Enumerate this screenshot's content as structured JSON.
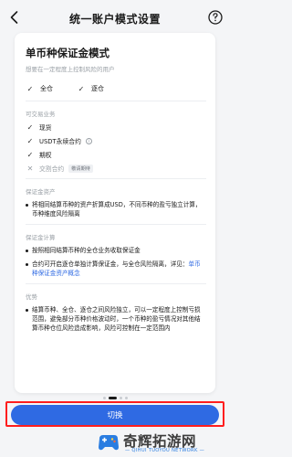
{
  "header": {
    "title": "统一账户模式设置",
    "back_icon": "back-chevron-icon",
    "help_icon": "help-circle-icon"
  },
  "card": {
    "title": "单币种保证金模式",
    "subtitle": "想要在一定程度上控制风险的用户",
    "modes": [
      {
        "label": "全仓",
        "icon": "check-icon"
      },
      {
        "label": "逐仓",
        "icon": "check-icon"
      }
    ],
    "tradable_section": {
      "label": "可交易业务",
      "items": [
        {
          "label": "现货",
          "enabled": true
        },
        {
          "label": "USDT永续合约",
          "enabled": true,
          "info_icon": "info-icon"
        },
        {
          "label": "期权",
          "enabled": true
        },
        {
          "label": "交割合约",
          "enabled": false,
          "badge": "敬请期待"
        }
      ]
    },
    "margin_assets": {
      "label": "保证金资产",
      "bullets": [
        "将相同结算币种的资产折算成USD，不同币种的盈亏独立计算，币种维度风险隔离"
      ]
    },
    "margin_calc": {
      "label": "保证金计算",
      "bullets": [
        {
          "text": "按照相同结算币种的全仓业务收取保证金"
        },
        {
          "text": "合约可开启逐仓单独计算保证金，与全仓风险隔离，详见：",
          "link": "单币种保证金资产概念"
        }
      ]
    },
    "advantages": {
      "label": "优势",
      "bullets": [
        "结算币种、全仓、逐仓之间风险独立，可以一定程度上控制亏损范围，避免部分币种价格波动时，一个币种的盈亏情况对其他结算币种仓位风险造成影响，风险可控制在一定范围内"
      ]
    }
  },
  "pager": {
    "total": 4,
    "active_index": 1
  },
  "button": {
    "label": "切换"
  },
  "watermark": {
    "text": "奇辉拓游网",
    "sub": "— QIHUI TUOYOU NETWORK —"
  },
  "colors": {
    "accent": "#2f6ae3",
    "highlight": "#ff1e1e",
    "background": "#f4f5f7"
  }
}
